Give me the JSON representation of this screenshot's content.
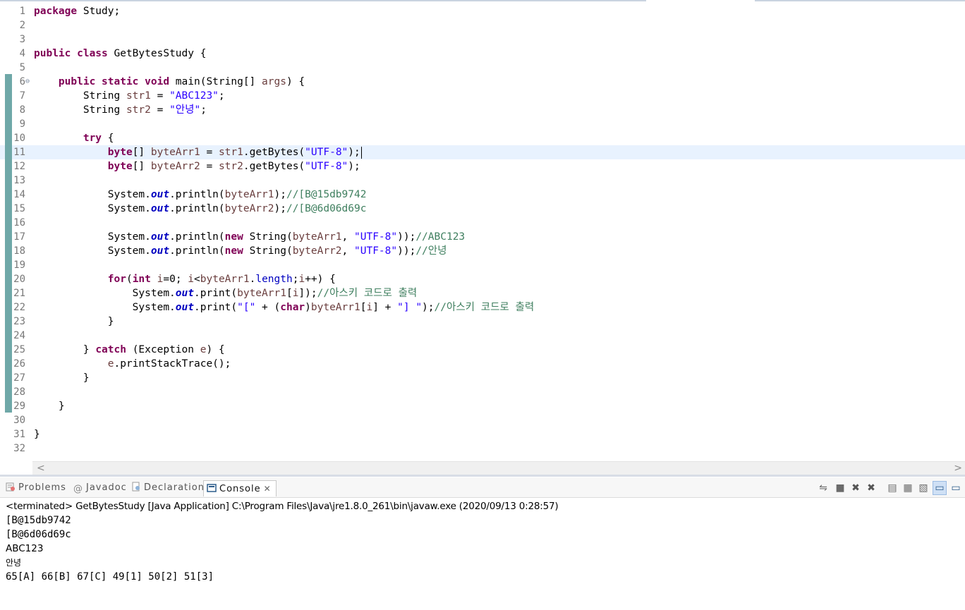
{
  "editor": {
    "lines": [
      {
        "n": "1",
        "html": "<span class=\"kw\">package</span> Study;"
      },
      {
        "n": "2",
        "html": ""
      },
      {
        "n": "3",
        "html": ""
      },
      {
        "n": "4",
        "html": "<span class=\"kw\">public class</span> GetBytesStudy {"
      },
      {
        "n": "5",
        "html": ""
      },
      {
        "n": "6",
        "html": "    <span class=\"kw\">public static void</span> main(String[] <span class=\"var\">args</span>) {",
        "fold": "⊖"
      },
      {
        "n": "7",
        "html": "        String <span class=\"var\">str1</span> = <span class=\"str\">\"ABC123\"</span>;"
      },
      {
        "n": "8",
        "html": "        String <span class=\"var\">str2</span> = <span class=\"str\">\"안녕\"</span>;"
      },
      {
        "n": "9",
        "html": ""
      },
      {
        "n": "10",
        "html": "        <span class=\"kw\">try</span> {"
      },
      {
        "n": "11",
        "html": "            <span class=\"kw\">byte</span>[] <span class=\"var\">byteArr1</span> = <span class=\"var\">str1</span>.getBytes(<span class=\"str\">\"UTF-8\"</span>);<span class=\"caret\"></span>",
        "current": true
      },
      {
        "n": "12",
        "html": "            <span class=\"kw\">byte</span>[] <span class=\"var\">byteArr2</span> = <span class=\"var\">str2</span>.getBytes(<span class=\"str\">\"UTF-8\"</span>);"
      },
      {
        "n": "13",
        "html": ""
      },
      {
        "n": "14",
        "html": "            System.<span class=\"fld\">out</span>.println(<span class=\"var\">byteArr1</span>);<span class=\"cmt\">//[B@15db9742</span>"
      },
      {
        "n": "15",
        "html": "            System.<span class=\"fld\">out</span>.println(<span class=\"var\">byteArr2</span>);<span class=\"cmt\">//[B@6d06d69c</span>"
      },
      {
        "n": "16",
        "html": ""
      },
      {
        "n": "17",
        "html": "            System.<span class=\"fld\">out</span>.println(<span class=\"kw\">new</span> String(<span class=\"var\">byteArr1</span>, <span class=\"str\">\"UTF-8\"</span>));<span class=\"cmt\">//ABC123</span>"
      },
      {
        "n": "18",
        "html": "            System.<span class=\"fld\">out</span>.println(<span class=\"kw\">new</span> String(<span class=\"var\">byteArr2</span>, <span class=\"str\">\"UTF-8\"</span>));<span class=\"cmt\">//안녕</span>"
      },
      {
        "n": "19",
        "html": ""
      },
      {
        "n": "20",
        "html": "            <span class=\"kw\">for</span>(<span class=\"kw\">int</span> <span class=\"var\">i</span>=0; <span class=\"var\">i</span>&lt;<span class=\"var\">byteArr1</span>.<span class=\"fldn\">length</span>;<span class=\"var\">i</span>++) {"
      },
      {
        "n": "21",
        "html": "                System.<span class=\"fld\">out</span>.print(<span class=\"var\">byteArr1</span>[<span class=\"var\">i</span>]);<span class=\"cmt\">//아스키 코드로 출력</span>"
      },
      {
        "n": "22",
        "html": "                System.<span class=\"fld\">out</span>.print(<span class=\"str\">\"[\"</span> + (<span class=\"kw\">char</span>)<span class=\"var\">byteArr1</span>[<span class=\"var\">i</span>] + <span class=\"str\">\"] \"</span>);<span class=\"cmt\">//아스키 코드로 출력</span>"
      },
      {
        "n": "23",
        "html": "            }"
      },
      {
        "n": "24",
        "html": ""
      },
      {
        "n": "25",
        "html": "        } <span class=\"kw\">catch</span> (Exception <span class=\"var\">e</span>) {"
      },
      {
        "n": "26",
        "html": "            <span class=\"var\">e</span>.printStackTrace();"
      },
      {
        "n": "27",
        "html": "        }"
      },
      {
        "n": "28",
        "html": ""
      },
      {
        "n": "29",
        "html": "    }"
      },
      {
        "n": "30",
        "html": ""
      },
      {
        "n": "31",
        "html": "}"
      },
      {
        "n": "32",
        "html": ""
      }
    ],
    "scroll_left": "<",
    "scroll_right": ">"
  },
  "views": {
    "tabs": [
      {
        "label": "Problems",
        "icon": "problems-icon"
      },
      {
        "label": "Javadoc",
        "icon": "javadoc-icon"
      },
      {
        "label": "Declaration",
        "icon": "declaration-icon"
      },
      {
        "label": "Console",
        "icon": "console-icon",
        "active": true
      }
    ],
    "toolbar_icons": [
      "remove-launch-icon",
      "terminate-icon",
      "remove-icon",
      "remove-all-icon",
      "scroll-lock-icon",
      "word-wrap-icon",
      "show-console-icon",
      "pin-console-icon",
      "display-selected-console-icon"
    ]
  },
  "console": {
    "header": "<terminated> GetBytesStudy [Java Application] C:\\Program Files\\Java\\jre1.8.0_261\\bin\\javaw.exe (2020/09/13 0:28:57)",
    "output": [
      "[B@15db9742",
      "[B@6d06d69c",
      "ABC123",
      "안녕",
      "65[A] 66[B] 67[C] 49[1] 50[2] 51[3]"
    ]
  },
  "colors": {
    "keyword": "#7f0055",
    "string": "#2a00ff",
    "comment": "#3f7f5f",
    "field": "#0000c0",
    "current_line": "#e8f2fe",
    "change_ruler": "#6fa8a8"
  }
}
